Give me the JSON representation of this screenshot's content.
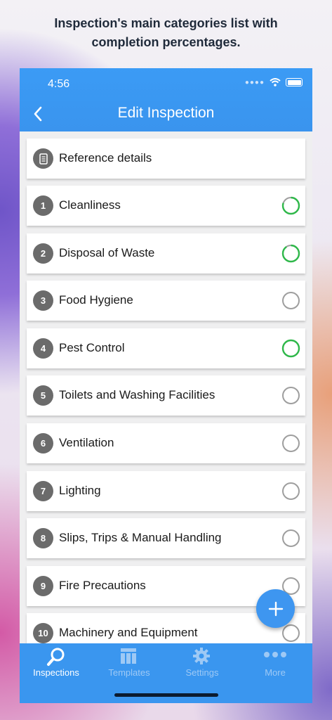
{
  "caption": "Inspection's main categories list with\ncompletion percentages.",
  "status_bar": {
    "time": "4:56"
  },
  "nav": {
    "title": "Edit Inspection",
    "back_icon": "chevron-left-icon"
  },
  "reference_row": {
    "label": "Reference details",
    "icon": "document-icon"
  },
  "categories": [
    {
      "number": "1",
      "label": "Cleanliness",
      "completion": 0.8,
      "status": "partial"
    },
    {
      "number": "2",
      "label": "Disposal of Waste",
      "completion": 0.9,
      "status": "partial"
    },
    {
      "number": "3",
      "label": "Food Hygiene",
      "completion": 0,
      "status": "empty"
    },
    {
      "number": "4",
      "label": "Pest Control",
      "completion": 1,
      "status": "complete"
    },
    {
      "number": "5",
      "label": "Toilets and Washing Facilities",
      "completion": 0,
      "status": "empty"
    },
    {
      "number": "6",
      "label": "Ventilation",
      "completion": 0,
      "status": "empty"
    },
    {
      "number": "7",
      "label": "Lighting",
      "completion": 0,
      "status": "empty"
    },
    {
      "number": "8",
      "label": "Slips, Trips & Manual Handling",
      "completion": 0,
      "status": "empty"
    },
    {
      "number": "9",
      "label": "Fire Precautions",
      "completion": 0,
      "status": "empty"
    },
    {
      "number": "10",
      "label": "Machinery and Equipment",
      "completion": 0,
      "status": "empty"
    }
  ],
  "fab": {
    "icon": "plus-icon"
  },
  "tabs": [
    {
      "label": "Inspections",
      "icon": "search-icon",
      "active": true
    },
    {
      "label": "Templates",
      "icon": "templates-icon",
      "active": false
    },
    {
      "label": "Settings",
      "icon": "gear-icon",
      "active": false
    },
    {
      "label": "More",
      "icon": "more-dots-icon",
      "active": false
    }
  ],
  "colors": {
    "accent": "#3a96ef",
    "complete": "#2fb84a",
    "empty_ring": "#9e9e9e",
    "badge": "#6b6b6b"
  }
}
